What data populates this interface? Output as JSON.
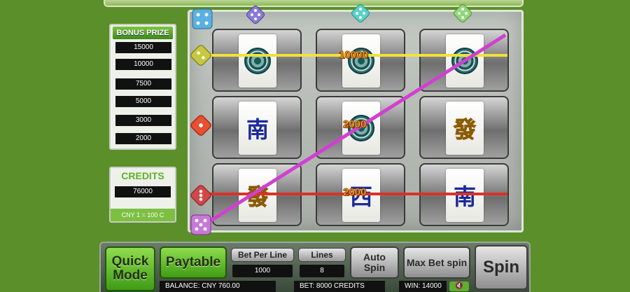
{
  "bonus_prize": {
    "title": "BONUS PRIZE",
    "values": [
      "15000",
      "10000",
      "7500",
      "5000",
      "3000",
      "2000"
    ]
  },
  "credits": {
    "title": "CREDITS",
    "value": "76000",
    "rate": "CNY 1 = 100 C"
  },
  "reels": {
    "rows": [
      [
        {
          "symbol": "coin-tile"
        },
        {
          "symbol": "coin-tile"
        },
        {
          "symbol": "coin-tile"
        }
      ],
      [
        {
          "symbol": "south-wind",
          "text": "南"
        },
        {
          "symbol": "coin-tile"
        },
        {
          "symbol": "green-dragon",
          "text": "發"
        }
      ],
      [
        {
          "symbol": "green-dragon",
          "text": "發"
        },
        {
          "symbol": "west-wind",
          "text": "西"
        },
        {
          "symbol": "south-wind",
          "text": "南"
        }
      ]
    ],
    "win_amounts": {
      "row1": "10000",
      "center": "2000",
      "row3": "2000"
    }
  },
  "controls": {
    "quick_mode": "Quick Mode",
    "paytable": "Paytable",
    "bet_per_line_label": "Bet Per Line",
    "bet_per_line_value": "1000",
    "lines_label": "Lines",
    "lines_value": "8",
    "auto_spin": "Auto Spin",
    "max_bet_spin": "Max Bet spin",
    "spin": "Spin"
  },
  "status": {
    "balance": "BALANCE: CNY 760.00",
    "bet": "BET: 8000 CREDITS",
    "win": "WIN: 14000"
  },
  "colors": {
    "background": "#5b8f2a",
    "payline_yellow": "#f0e23a",
    "payline_red": "#d8322a",
    "payline_magenta": "#d040d0",
    "accent_green": "#7cc042"
  },
  "icons": [
    "die-icon",
    "mute-icon"
  ]
}
